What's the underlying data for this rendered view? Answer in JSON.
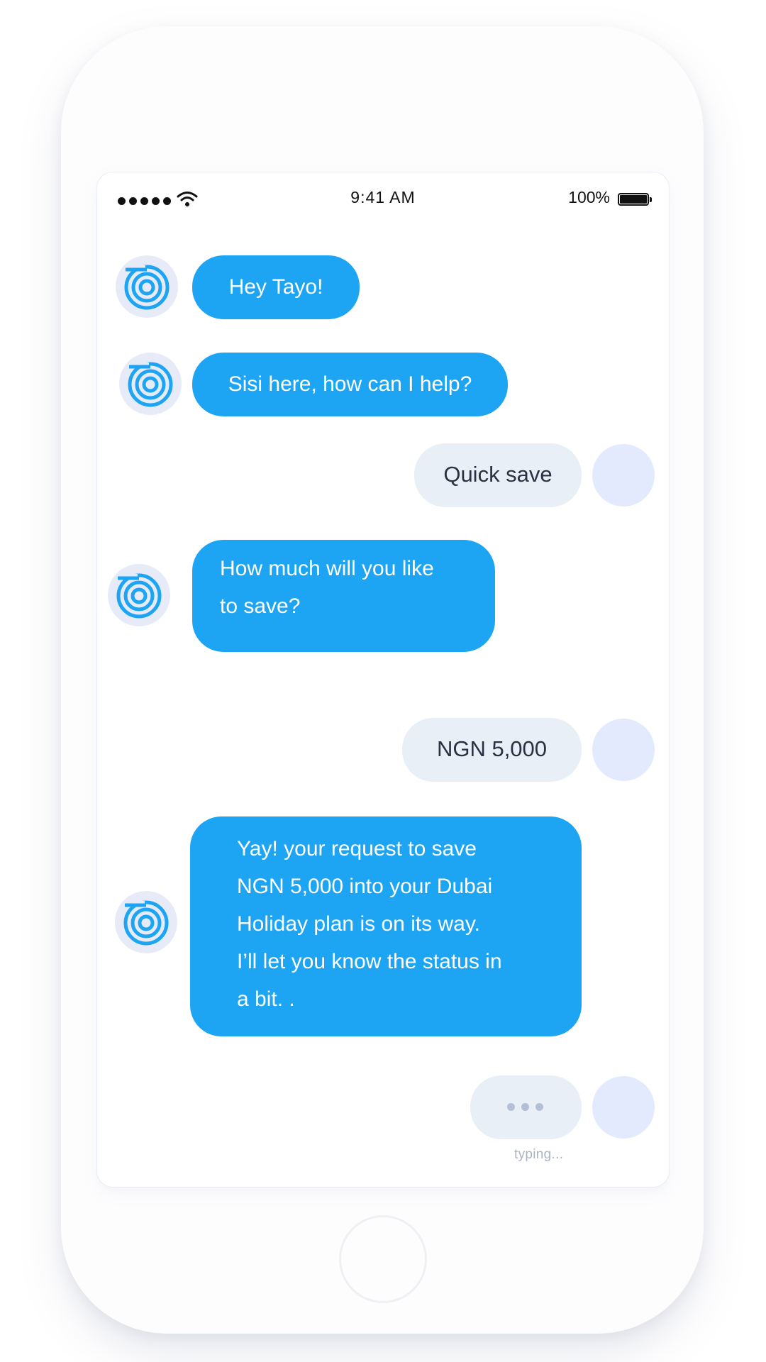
{
  "status_bar": {
    "time": "9:41 AM",
    "battery_percent_label": "100%",
    "battery_level": 1.0,
    "signal_bars": 5,
    "icons": [
      "signal-dots-icon",
      "wifi-icon",
      "battery-icon"
    ]
  },
  "chat": {
    "bot_avatar_icon": "concentric-circles-logo-icon",
    "messages": [
      {
        "sender": "bot",
        "text": "Hey Tayo!"
      },
      {
        "sender": "bot",
        "text": "Sisi here, how can I help?"
      },
      {
        "sender": "user",
        "text": "Quick save"
      },
      {
        "sender": "bot",
        "lines": [
          "How much will you like",
          "to save?"
        ]
      },
      {
        "sender": "user",
        "text": "NGN 5,000"
      },
      {
        "sender": "bot",
        "lines": [
          "Yay! your request to save",
          "NGN 5,000 into your Dubai",
          "Holiday plan is on its way.",
          "I’ll let you know the status in",
          "a bit. ."
        ]
      }
    ],
    "typing": {
      "sender": "user",
      "label": "typing..."
    }
  },
  "colors": {
    "bot_bubble": "#1da5f3",
    "user_bubble": "#e9eff7",
    "user_avatar": "#e3eafd",
    "bot_avatar_bg": "#e7ebf7"
  }
}
